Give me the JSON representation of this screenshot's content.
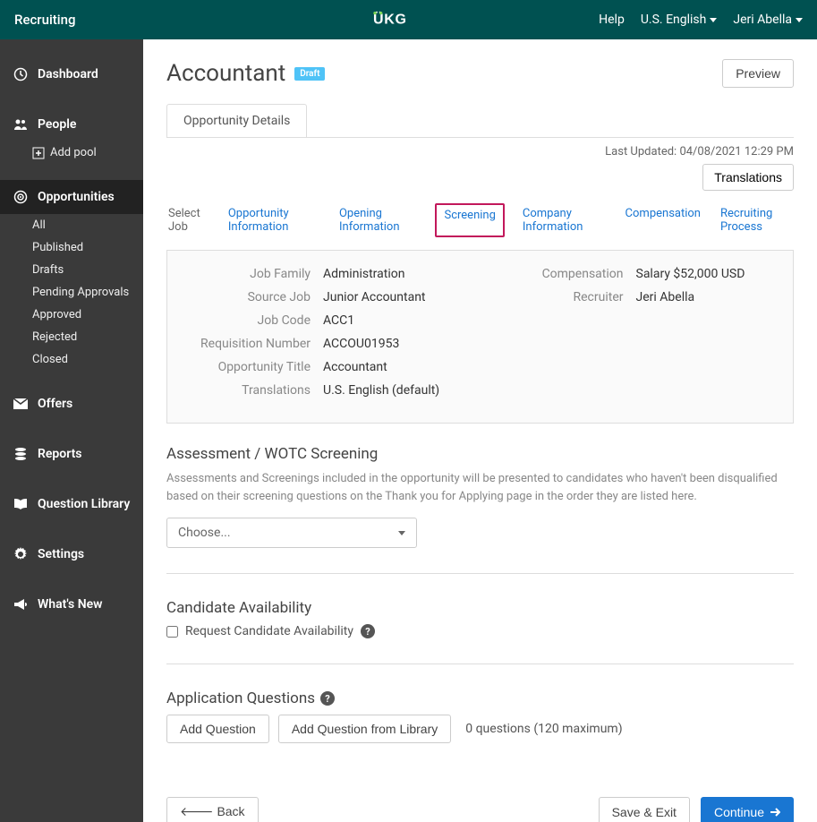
{
  "topbar": {
    "brand": "Recruiting",
    "help": "Help",
    "language": "U.S. English",
    "user": "Jeri Abella"
  },
  "sidebar": {
    "dashboard": "Dashboard",
    "people": "People",
    "add_pool": "Add pool",
    "opportunities": "Opportunities",
    "opp_subs": [
      "All",
      "Published",
      "Drafts",
      "Pending Approvals",
      "Approved",
      "Rejected",
      "Closed"
    ],
    "offers": "Offers",
    "reports": "Reports",
    "question_library": "Question Library",
    "settings": "Settings",
    "whats_new": "What's New"
  },
  "header": {
    "title": "Accountant",
    "badge": "Draft",
    "preview_btn": "Preview"
  },
  "tabs": {
    "main_tab": "Opportunity Details"
  },
  "meta": {
    "last_updated_label": "Last Updated:",
    "last_updated_value": "04/08/2021 12:29 PM",
    "translations_btn": "Translations"
  },
  "steps": {
    "select_job": "Select Job",
    "opportunity_info": "Opportunity Information",
    "opening_info": "Opening Information",
    "screening": "Screening",
    "company_info": "Company Information",
    "compensation": "Compensation",
    "recruiting_process": "Recruiting Process"
  },
  "info": {
    "labels": {
      "job_family": "Job Family",
      "source_job": "Source Job",
      "job_code": "Job Code",
      "req_number": "Requisition Number",
      "opp_title": "Opportunity Title",
      "translations": "Translations",
      "compensation": "Compensation",
      "recruiter": "Recruiter"
    },
    "values": {
      "job_family": "Administration",
      "source_job": "Junior Accountant",
      "job_code": "ACC1",
      "req_number": "ACCOU01953",
      "opp_title": "Accountant",
      "translations": "U.S. English (default)",
      "compensation": "Salary $52,000 USD",
      "recruiter": "Jeri Abella"
    }
  },
  "assessment": {
    "title": "Assessment / WOTC Screening",
    "desc": "Assessments and Screenings included in the opportunity will be presented to candidates who haven't been disqualified based on their screening questions on the Thank you for Applying page in the order they are listed here.",
    "choose": "Choose..."
  },
  "availability": {
    "title": "Candidate Availability",
    "checkbox_label": "Request Candidate Availability"
  },
  "questions": {
    "title": "Application Questions",
    "add_btn": "Add Question",
    "add_library_btn": "Add Question from Library",
    "count": "0 questions (120 maximum)"
  },
  "footer": {
    "back": "Back",
    "save_exit": "Save & Exit",
    "continue": "Continue"
  }
}
